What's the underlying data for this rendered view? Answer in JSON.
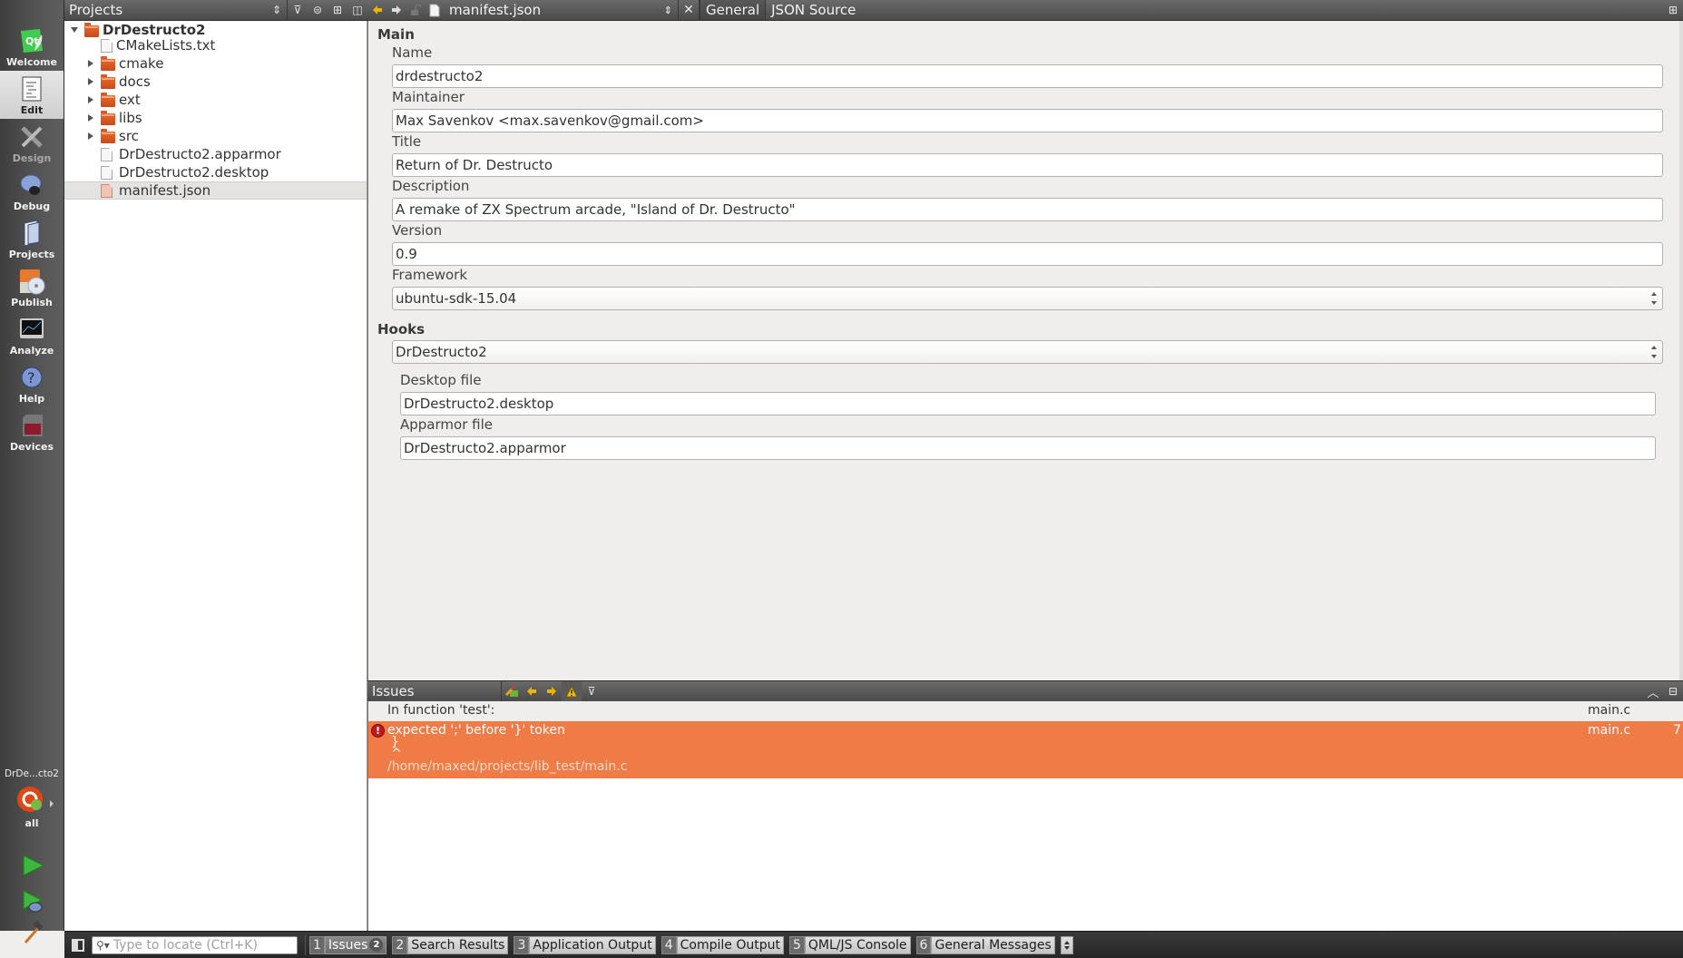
{
  "modes": [
    {
      "label": "Welcome",
      "icon": "qt-logo-icon",
      "state": "normal"
    },
    {
      "label": "Edit",
      "icon": "edit-document-icon",
      "state": "active"
    },
    {
      "label": "Design",
      "icon": "design-tools-icon",
      "state": "disabled"
    },
    {
      "label": "Debug",
      "icon": "debug-bug-icon",
      "state": "normal"
    },
    {
      "label": "Projects",
      "icon": "projects-book-icon",
      "state": "normal"
    },
    {
      "label": "Publish",
      "icon": "publish-disc-icon",
      "state": "normal"
    },
    {
      "label": "Analyze",
      "icon": "analyze-monitor-icon",
      "state": "normal"
    },
    {
      "label": "Help",
      "icon": "help-question-icon",
      "state": "normal"
    },
    {
      "label": "Devices",
      "icon": "devices-phone-icon",
      "state": "normal"
    }
  ],
  "kit": {
    "project": "DrDe...cto2",
    "build": "all"
  },
  "projects_pane": {
    "title": "Projects",
    "tree": [
      {
        "label": "DrDestructo2",
        "type": "project",
        "level": 0,
        "expanded": true
      },
      {
        "label": "CMakeLists.txt",
        "type": "file",
        "level": 1
      },
      {
        "label": "cmake",
        "type": "folder",
        "level": 1,
        "expanded": false
      },
      {
        "label": "docs",
        "type": "folder",
        "level": 1,
        "expanded": false
      },
      {
        "label": "ext",
        "type": "folder",
        "level": 1,
        "expanded": false
      },
      {
        "label": "libs",
        "type": "folder",
        "level": 1,
        "expanded": false
      },
      {
        "label": "src",
        "type": "folder",
        "level": 1,
        "expanded": false
      },
      {
        "label": "DrDestructo2.apparmor",
        "type": "file",
        "level": 1
      },
      {
        "label": "DrDestructo2.desktop",
        "type": "file",
        "level": 1
      },
      {
        "label": "manifest.json",
        "type": "json",
        "level": 1,
        "selected": true
      }
    ]
  },
  "editor": {
    "document": "manifest.json",
    "tabs": [
      {
        "label": "General",
        "active": true
      },
      {
        "label": "JSON Source",
        "active": false
      }
    ],
    "main_section": "Main",
    "fields": {
      "name": {
        "label": "Name",
        "value": "drdestructo2"
      },
      "maintainer": {
        "label": "Maintainer",
        "value": "Max Savenkov <max.savenkov@gmail.com>"
      },
      "title": {
        "label": "Title",
        "value": "Return of Dr. Destructo"
      },
      "description": {
        "label": "Description",
        "value": "A remake of ZX Spectrum arcade, \"Island of Dr. Destructo\""
      },
      "version": {
        "label": "Version",
        "value": "0.9"
      },
      "framework": {
        "label": "Framework",
        "value": "ubuntu-sdk-15.04"
      }
    },
    "hooks_section": "Hooks",
    "hook_selected": "DrDestructo2",
    "hook_fields": {
      "desktop": {
        "label": "Desktop file",
        "value": "DrDestructo2.desktop"
      },
      "apparmor": {
        "label": "Apparmor file",
        "value": "DrDestructo2.apparmor"
      }
    }
  },
  "issues": {
    "title": "Issues",
    "context": {
      "text": "In function 'test':",
      "file": "main.c"
    },
    "error": {
      "message": "expected ';' before '}' token",
      "code_line": "}",
      "caret": "^",
      "path": "/home/maxed/projects/lib_test/main.c",
      "file": "main.c",
      "line": "7"
    },
    "error_color": "#ef7b47"
  },
  "statusbar": {
    "locator_placeholder": "Type to locate (Ctrl+K)",
    "outputs": [
      {
        "num": "1",
        "label": "Issues",
        "badge": "2"
      },
      {
        "num": "2",
        "label": "Search Results"
      },
      {
        "num": "3",
        "label": "Application Output"
      },
      {
        "num": "4",
        "label": "Compile Output"
      },
      {
        "num": "5",
        "label": "QML/JS Console"
      },
      {
        "num": "6",
        "label": "General Messages"
      }
    ]
  }
}
